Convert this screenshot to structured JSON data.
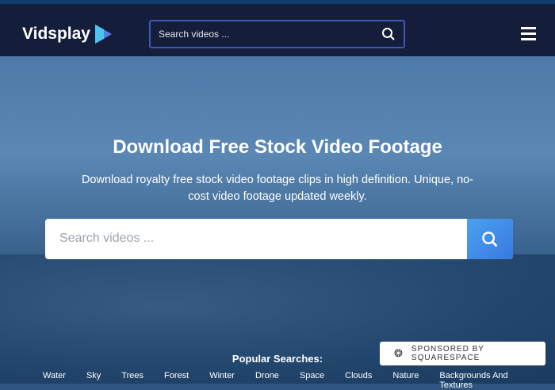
{
  "header": {
    "logo": "Vidsplay",
    "search_placeholder": "Search videos ..."
  },
  "hero": {
    "title": "Download Free Stock Video Footage",
    "subtitle": "Download royalty free stock video footage clips in high definition. Unique, no-cost video footage updated weekly.",
    "search_placeholder": "Search videos ..."
  },
  "popular": {
    "label": "Popular Searches:",
    "tags": [
      "Water",
      "Sky",
      "Trees",
      "Forest",
      "Winter",
      "Drone",
      "Space",
      "Clouds",
      "Nature",
      "Backgrounds And Textures"
    ]
  },
  "sponsor": {
    "label": "SPONSORED BY SQUARESPACE"
  }
}
